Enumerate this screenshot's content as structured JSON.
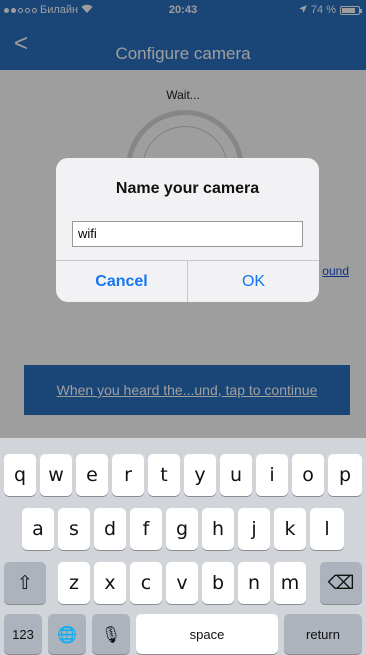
{
  "status_bar": {
    "carrier": "Билайн",
    "time": "20:43",
    "battery": "74 %",
    "battery_level": 0.74
  },
  "nav": {
    "back_glyph": "<",
    "title": "Configure camera"
  },
  "content": {
    "wait_text": "Wait...",
    "sound_link": "ound",
    "continue_label": "When you heard the...und, tap to continue"
  },
  "alert": {
    "title": "Name your camera",
    "input_value": "wifi",
    "cancel": "Cancel",
    "ok": "OK"
  },
  "keyboard": {
    "row1": [
      "q",
      "w",
      "e",
      "r",
      "t",
      "y",
      "u",
      "i",
      "o",
      "p"
    ],
    "row2": [
      "a",
      "s",
      "d",
      "f",
      "g",
      "h",
      "j",
      "k",
      "l"
    ],
    "row3": [
      "z",
      "x",
      "c",
      "v",
      "b",
      "n",
      "m"
    ],
    "shift_glyph": "⇧",
    "delete_glyph": "⌫",
    "numbers_label": "123",
    "globe_glyph": "🌐",
    "mic_glyph": "🎙",
    "space_label": "space",
    "return_label": "return"
  },
  "colors": {
    "brand_blue": "#2b72c1",
    "alert_button_blue": "#1576f3",
    "link_blue": "#1b4fd6"
  }
}
